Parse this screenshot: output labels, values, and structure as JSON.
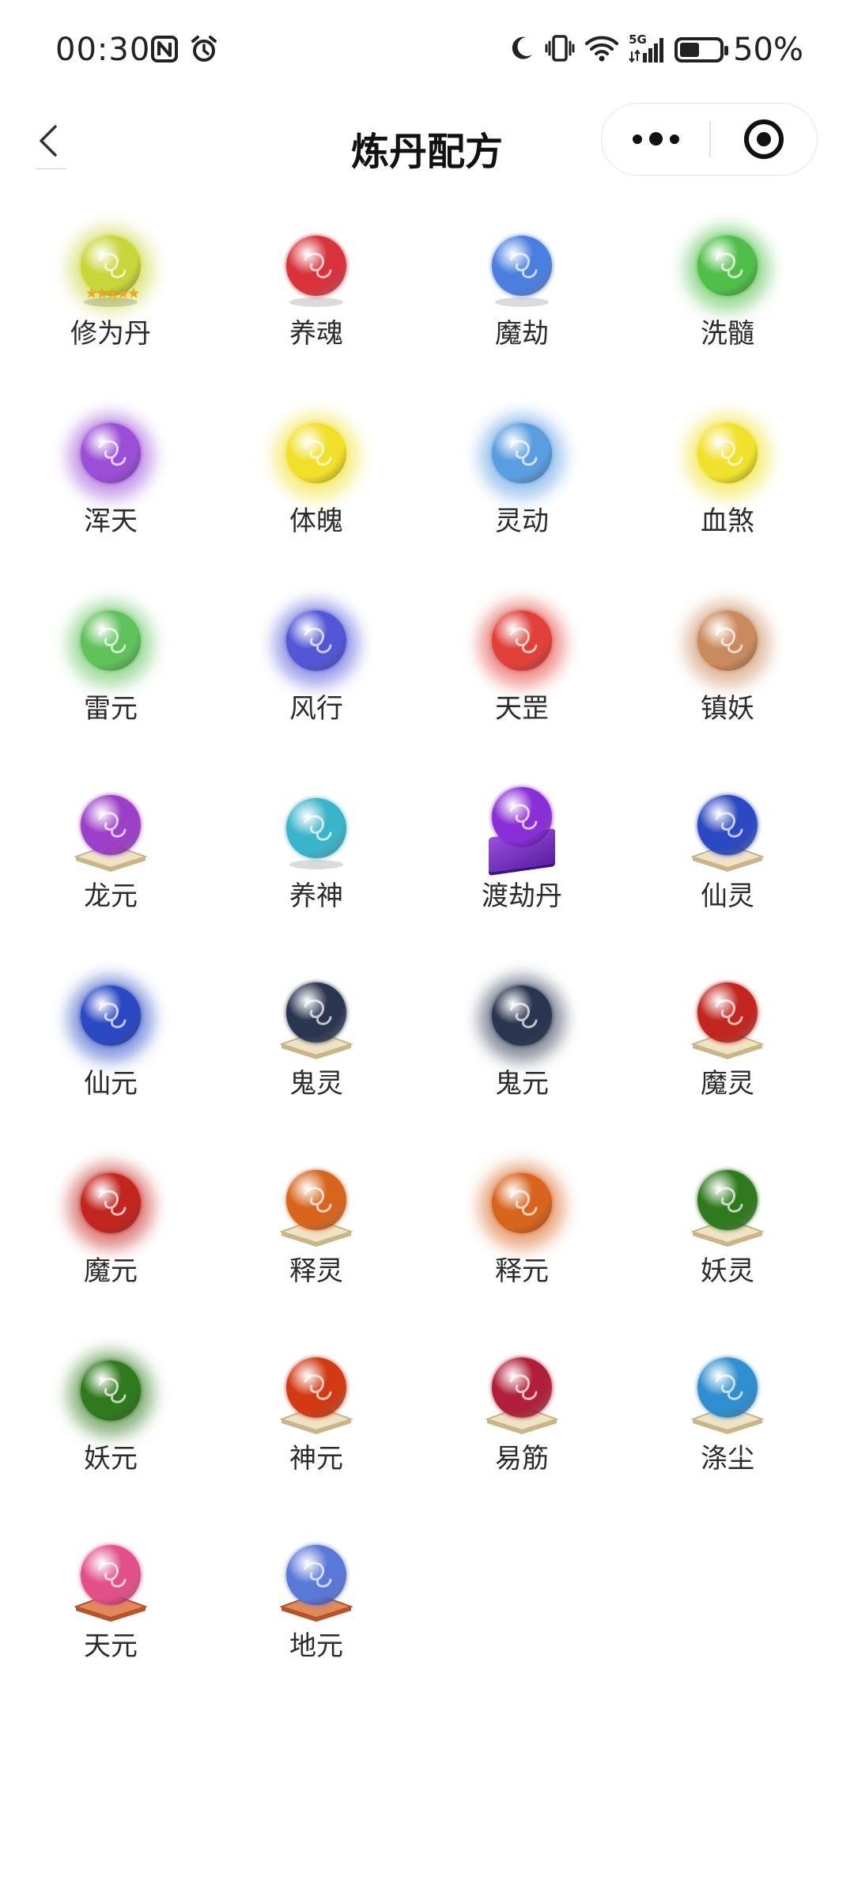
{
  "status_bar": {
    "time": "00:30",
    "battery_percent": "50%",
    "battery_level": 0.5,
    "network": "5G",
    "icons": [
      "nfc-icon",
      "alarm-icon",
      "moon-icon",
      "vibrate-icon",
      "wifi-icon",
      "signal-icon",
      "battery-icon"
    ]
  },
  "nav": {
    "title": "炼丹配方",
    "back_icon": "chevron-left-icon",
    "more_icon": "more-dots-icon",
    "close_icon": "target-circle-icon"
  },
  "recipes": [
    {
      "name": "修为丹",
      "color": "#c9d63a",
      "style": "star"
    },
    {
      "name": "养魂",
      "color": "#d8333a",
      "style": "shadow"
    },
    {
      "name": "魔劫",
      "color": "#4a7fe0",
      "style": "shadow"
    },
    {
      "name": "洗髓",
      "color": "#4fbf4a",
      "style": "glow"
    },
    {
      "name": "浑天",
      "color": "#9b4fd6",
      "style": "glow"
    },
    {
      "name": "体魄",
      "color": "#f2df2a",
      "style": "glow"
    },
    {
      "name": "灵动",
      "color": "#5b9ee0",
      "style": "glow"
    },
    {
      "name": "血煞",
      "color": "#f0e12c",
      "style": "glow"
    },
    {
      "name": "雷元",
      "color": "#5fc25a",
      "style": "glow"
    },
    {
      "name": "风行",
      "color": "#5357d6",
      "style": "glow"
    },
    {
      "name": "天罡",
      "color": "#e0423a",
      "style": "glow"
    },
    {
      "name": "镇妖",
      "color": "#c98a5d",
      "style": "glow"
    },
    {
      "name": "龙元",
      "color": "#9c3fc9",
      "style": "pedestal"
    },
    {
      "name": "养神",
      "color": "#3ab4c9",
      "style": "shadow"
    },
    {
      "name": "渡劫丹",
      "color": "#8a2fd6",
      "style": "box"
    },
    {
      "name": "仙灵",
      "color": "#2a49c2",
      "style": "pedestal"
    },
    {
      "name": "仙元",
      "color": "#2a49c2",
      "style": "glow"
    },
    {
      "name": "鬼灵",
      "color": "#2a3550",
      "style": "pedestal"
    },
    {
      "name": "鬼元",
      "color": "#2a3550",
      "style": "glow"
    },
    {
      "name": "魔灵",
      "color": "#c2261e",
      "style": "pedestal"
    },
    {
      "name": "魔元",
      "color": "#c2261e",
      "style": "glow"
    },
    {
      "name": "释灵",
      "color": "#d8651e",
      "style": "pedestal"
    },
    {
      "name": "释元",
      "color": "#d8651e",
      "style": "glow"
    },
    {
      "name": "妖灵",
      "color": "#2e7a1c",
      "style": "pedestal"
    },
    {
      "name": "妖元",
      "color": "#2e7a1c",
      "style": "glow"
    },
    {
      "name": "神元",
      "color": "#d13a12",
      "style": "pedestal"
    },
    {
      "name": "易筋",
      "color": "#b0203a",
      "style": "pedestal"
    },
    {
      "name": "涤尘",
      "color": "#2f8fd0",
      "style": "pedestal"
    },
    {
      "name": "天元",
      "color": "#e2508a",
      "style": "pedestal-red"
    },
    {
      "name": "地元",
      "color": "#5a78d8",
      "style": "pedestal-red"
    }
  ]
}
